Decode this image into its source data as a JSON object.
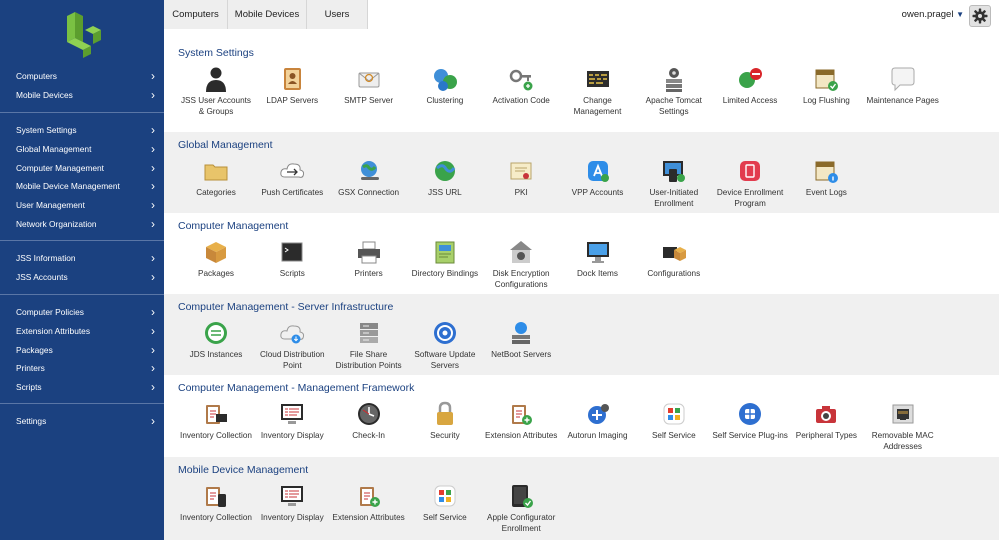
{
  "sidebar": {
    "groups": [
      [
        "Computers",
        "Mobile Devices"
      ],
      [
        "System Settings",
        "Global Management",
        "Computer Management",
        "Mobile Device Management",
        "User Management",
        "Network Organization"
      ],
      [
        "JSS Information",
        "JSS Accounts"
      ],
      [
        "Computer Policies",
        "Extension Attributes",
        "Packages",
        "Printers",
        "Scripts"
      ],
      [
        "Settings"
      ]
    ]
  },
  "tabs": [
    "Computers",
    "Mobile Devices",
    "Users"
  ],
  "user": {
    "name": "owen.pragel",
    "caret": "▼"
  },
  "colors": {
    "sidebar": "#1b4180",
    "accent": "#1b4180",
    "alt_row": "#f0f0f0"
  },
  "sections": [
    {
      "title": "System Settings",
      "items": [
        {
          "label": "JSS User Accounts & Groups",
          "icon": "user-icon"
        },
        {
          "label": "LDAP Servers",
          "icon": "address-book-icon"
        },
        {
          "label": "SMTP Server",
          "icon": "envelope-icon"
        },
        {
          "label": "Clustering",
          "icon": "globe-cluster-icon"
        },
        {
          "label": "Activation Code",
          "icon": "key-icon"
        },
        {
          "label": "Change Management",
          "icon": "ticker-board-icon"
        },
        {
          "label": "Apache Tomcat Settings",
          "icon": "server-gear-icon"
        },
        {
          "label": "Limited Access",
          "icon": "restricted-icon"
        },
        {
          "label": "Log Flushing",
          "icon": "calendar-check-icon"
        },
        {
          "label": "Maintenance Pages",
          "icon": "speech-bubble-icon"
        }
      ]
    },
    {
      "title": "Global Management",
      "items": [
        {
          "label": "Categories",
          "icon": "folder-icon"
        },
        {
          "label": "Push Certificates",
          "icon": "cloud-arrows-icon"
        },
        {
          "label": "GSX Connection",
          "icon": "globe-wrench-icon"
        },
        {
          "label": "JSS URL",
          "icon": "globe-link-icon"
        },
        {
          "label": "PKI",
          "icon": "certificate-icon"
        },
        {
          "label": "VPP Accounts",
          "icon": "app-store-icon"
        },
        {
          "label": "User-Initiated Enrollment",
          "icon": "devices-plus-icon"
        },
        {
          "label": "Device Enrollment Program",
          "icon": "enrollment-icon"
        },
        {
          "label": "Event Logs",
          "icon": "calendar-info-icon"
        }
      ]
    },
    {
      "title": "Computer Management",
      "items": [
        {
          "label": "Packages",
          "icon": "package-icon"
        },
        {
          "label": "Scripts",
          "icon": "terminal-icon"
        },
        {
          "label": "Printers",
          "icon": "printer-icon"
        },
        {
          "label": "Directory Bindings",
          "icon": "directory-icon"
        },
        {
          "label": "Disk Encryption Configurations",
          "icon": "house-lock-icon"
        },
        {
          "label": "Dock Items",
          "icon": "monitor-icon"
        },
        {
          "label": "Configurations",
          "icon": "configurations-icon"
        }
      ]
    },
    {
      "title": "Computer Management - Server Infrastructure",
      "items": [
        {
          "label": "JDS Instances",
          "icon": "jds-icon"
        },
        {
          "label": "Cloud Distribution Point",
          "icon": "cloud-download-icon"
        },
        {
          "label": "File Share Distribution Points",
          "icon": "file-server-icon"
        },
        {
          "label": "Software Update Servers",
          "icon": "software-update-icon"
        },
        {
          "label": "NetBoot Servers",
          "icon": "netboot-icon"
        }
      ]
    },
    {
      "title": "Computer Management - Management Framework",
      "items": [
        {
          "label": "Inventory Collection",
          "icon": "clipboard-monitor-icon"
        },
        {
          "label": "Inventory Display",
          "icon": "inventory-display-icon"
        },
        {
          "label": "Check-In",
          "icon": "clock-icon"
        },
        {
          "label": "Security",
          "icon": "padlock-icon"
        },
        {
          "label": "Extension Attributes",
          "icon": "clipboard-plus-icon"
        },
        {
          "label": "Autorun Imaging",
          "icon": "autorun-icon"
        },
        {
          "label": "Self Service",
          "icon": "self-service-icon"
        },
        {
          "label": "Self Service Plug-ins",
          "icon": "plugin-icon"
        },
        {
          "label": "Peripheral Types",
          "icon": "camera-icon"
        },
        {
          "label": "Removable MAC Addresses",
          "icon": "ethernet-port-icon"
        }
      ]
    },
    {
      "title": "Mobile Device Management",
      "items": [
        {
          "label": "Inventory Collection",
          "icon": "clipboard-phone-icon"
        },
        {
          "label": "Inventory Display",
          "icon": "inventory-display-icon"
        },
        {
          "label": "Extension Attributes",
          "icon": "clipboard-plus-icon"
        },
        {
          "label": "Self Service",
          "icon": "self-service-icon"
        },
        {
          "label": "Apple Configurator Enrollment",
          "icon": "tablet-check-icon"
        }
      ]
    }
  ]
}
